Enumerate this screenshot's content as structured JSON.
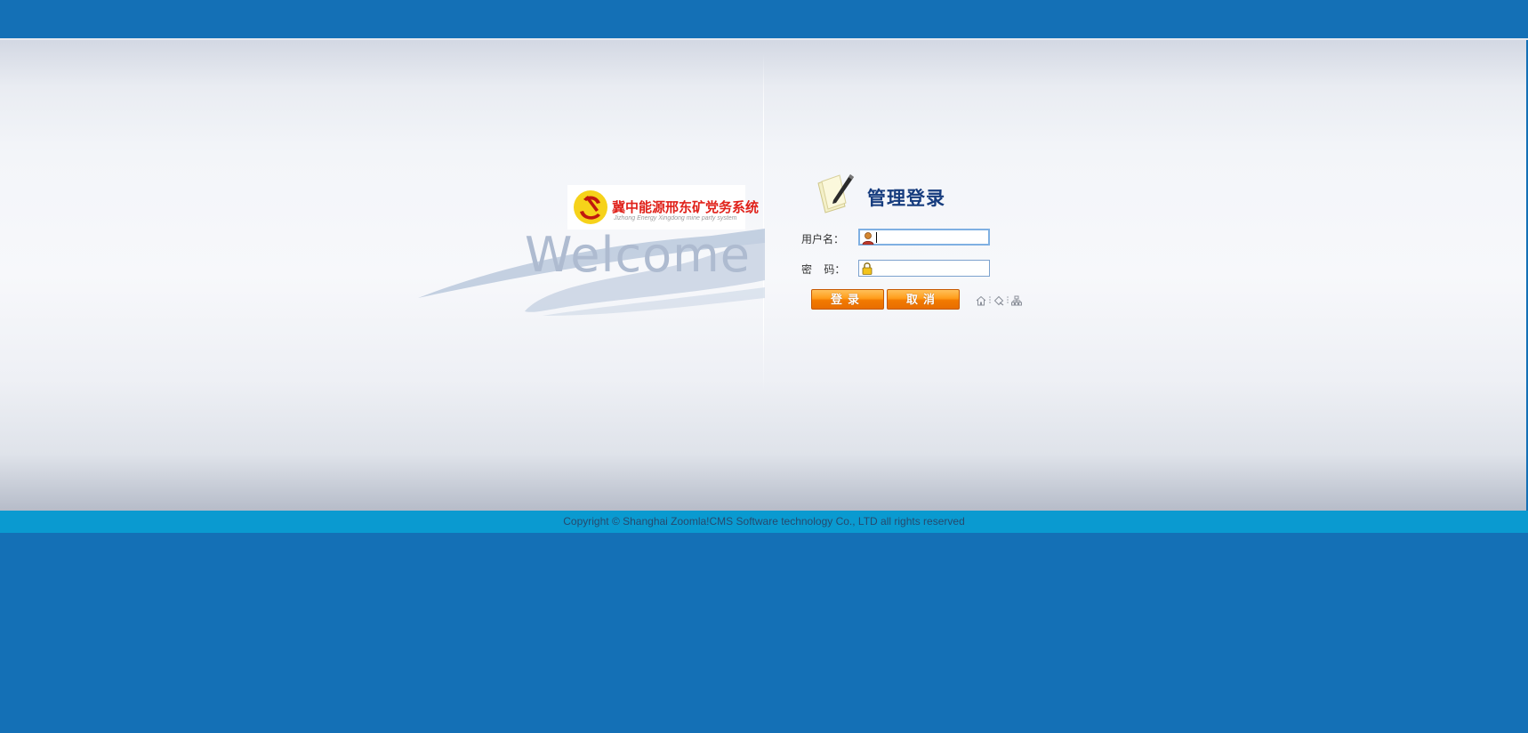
{
  "welcome_text": "Welcome",
  "logo": {
    "title": "冀中能源邢东矿党务系统",
    "subtitle": "Jizhong Energy Xingdong mine party system"
  },
  "login": {
    "title": "管理登录",
    "username_label": "用户名：",
    "password_label_char1": "密",
    "password_label_char2": "码：",
    "username_value": "",
    "password_value": "",
    "login_button": "登录",
    "cancel_button": "取消"
  },
  "quick_icons": [
    "home-icon",
    "favorite-icon",
    "sitemap-icon"
  ],
  "footer": {
    "copyright": "Copyright © Shanghai Zoomla!CMS Software technology Co., LTD all rights reserved"
  },
  "colors": {
    "page_bg": "#1470b6",
    "footer_bg": "#0a9ad0",
    "title": "#163c7e",
    "button": "#f58a0a"
  }
}
